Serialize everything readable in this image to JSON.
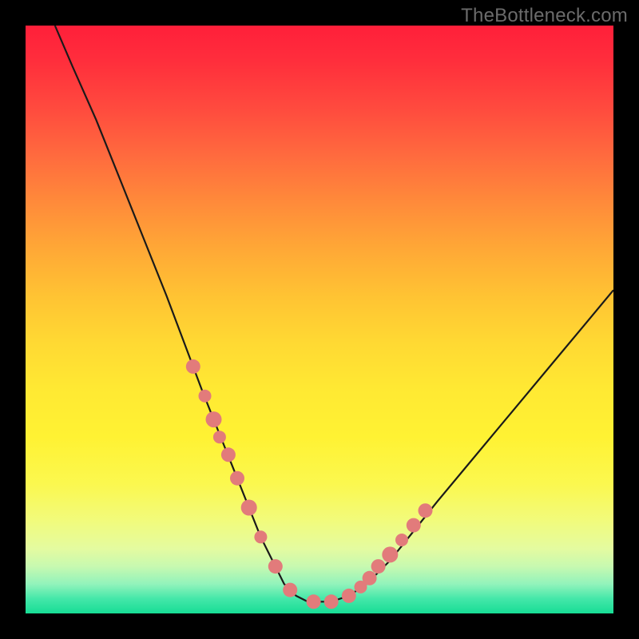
{
  "watermark": "TheBottleneck.com",
  "colors": {
    "frame": "#000000",
    "curve_stroke": "#1a1a1a",
    "marker_fill": "#e27b7b",
    "marker_stroke": "#c96262"
  },
  "chart_data": {
    "type": "line",
    "title": "",
    "xlabel": "",
    "ylabel": "",
    "xlim": [
      0,
      100
    ],
    "ylim": [
      0,
      100
    ],
    "grid": false,
    "curve": {
      "x": [
        5,
        8,
        12,
        16,
        20,
        24,
        27,
        30,
        32,
        34,
        36,
        38,
        40,
        42,
        44,
        46,
        48,
        50,
        52,
        55,
        58,
        62,
        66,
        70,
        75,
        80,
        85,
        90,
        95,
        100
      ],
      "y": [
        100,
        93,
        84,
        74,
        64,
        54,
        46,
        38,
        33,
        28,
        23,
        18,
        13,
        9,
        5,
        3,
        2,
        2,
        2,
        3,
        5,
        9,
        14,
        19,
        25,
        31,
        37,
        43,
        49,
        55
      ]
    },
    "markers": {
      "x": [
        28.5,
        30.5,
        32.0,
        33.0,
        34.5,
        36.0,
        38.0,
        40.0,
        42.5,
        45.0,
        49.0,
        52.0,
        55.0,
        57.0,
        58.5,
        60.0,
        62.0,
        64.0,
        66.0,
        68.0
      ],
      "y": [
        42.0,
        37.0,
        33.0,
        30.0,
        27.0,
        23.0,
        18.0,
        13.0,
        8.0,
        4.0,
        2.0,
        2.0,
        3.0,
        4.5,
        6.0,
        8.0,
        10.0,
        12.5,
        15.0,
        17.5
      ],
      "r": [
        9,
        8,
        10,
        8,
        9,
        9,
        10,
        8,
        9,
        9,
        9,
        9,
        9,
        8,
        9,
        9,
        10,
        8,
        9,
        9
      ]
    }
  }
}
